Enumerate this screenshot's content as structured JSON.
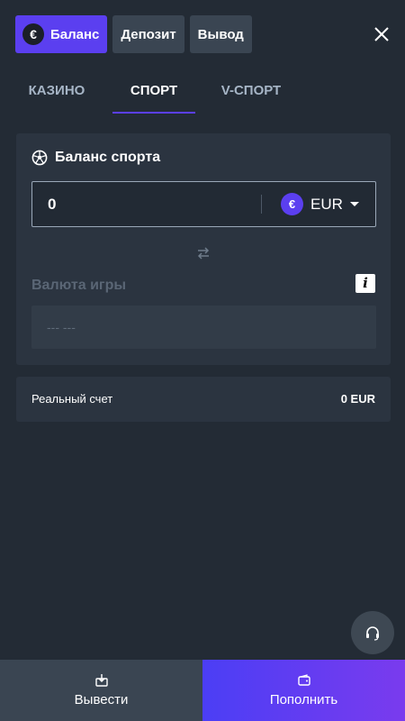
{
  "header": {
    "tabs": [
      {
        "label": "Баланс",
        "icon": "euro-coin-icon",
        "active": true
      },
      {
        "label": "Депозит",
        "active": false
      },
      {
        "label": "Вывод",
        "active": false
      }
    ],
    "coin_symbol": "€"
  },
  "subtabs": [
    {
      "label": "КАЗИНО",
      "active": false
    },
    {
      "label": "СПОРТ",
      "active": true
    },
    {
      "label": "V-СПОРТ",
      "active": false
    }
  ],
  "sport_balance": {
    "title": "Баланс спорта",
    "amount": "0",
    "currency_symbol": "€",
    "currency": "EUR",
    "game_currency_label": "Валюта игры",
    "game_currency_value": "--- ---"
  },
  "account": {
    "label": "Реальный счет",
    "value": "0 EUR"
  },
  "bottom": {
    "withdraw_label": "Вывести",
    "deposit_label": "Пополнить"
  },
  "colors": {
    "accent": "#5b3ff0",
    "background": "#232b35",
    "card": "#2b3440"
  }
}
